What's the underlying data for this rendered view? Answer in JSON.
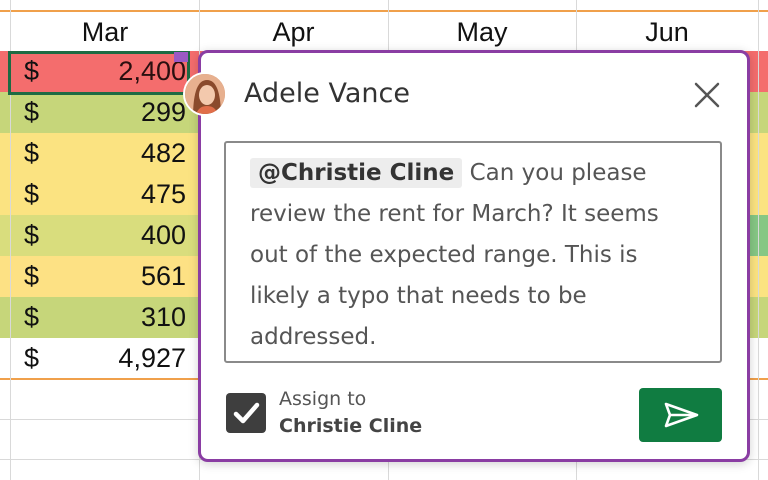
{
  "sheet": {
    "columns": [
      "Mar",
      "Apr",
      "May",
      "Jun"
    ],
    "currency_symbol": "$",
    "rows": [
      {
        "value": "2,400",
        "color": "#f46d6d"
      },
      {
        "value": "299",
        "color": "#c6d67a"
      },
      {
        "value": "482",
        "color": "#fbe381"
      },
      {
        "value": "475",
        "color": "#fbe381"
      },
      {
        "value": "400",
        "color": "#d9dd7d"
      },
      {
        "value": "561",
        "color": "#fde184"
      },
      {
        "value": "310",
        "color": "#c6d67a"
      }
    ],
    "total": "4,927"
  },
  "comment": {
    "author": "Adele Vance",
    "mention": "@Christie Cline",
    "lines": [
      "Can you please",
      "review the rent for March? It seems",
      "out of the expected range. This is",
      "likely a typo that needs to be",
      "addressed."
    ],
    "assign_label": "Assign to",
    "assign_name": "Christie Cline",
    "assign_checked": true,
    "icons": {
      "close": "close-icon",
      "send": "send-icon",
      "check": "checkmark-icon",
      "avatar": "avatar"
    },
    "colors": {
      "card_border": "#8a3da3",
      "send_button": "#107c41",
      "active_cell_border": "#1e6b43"
    }
  }
}
